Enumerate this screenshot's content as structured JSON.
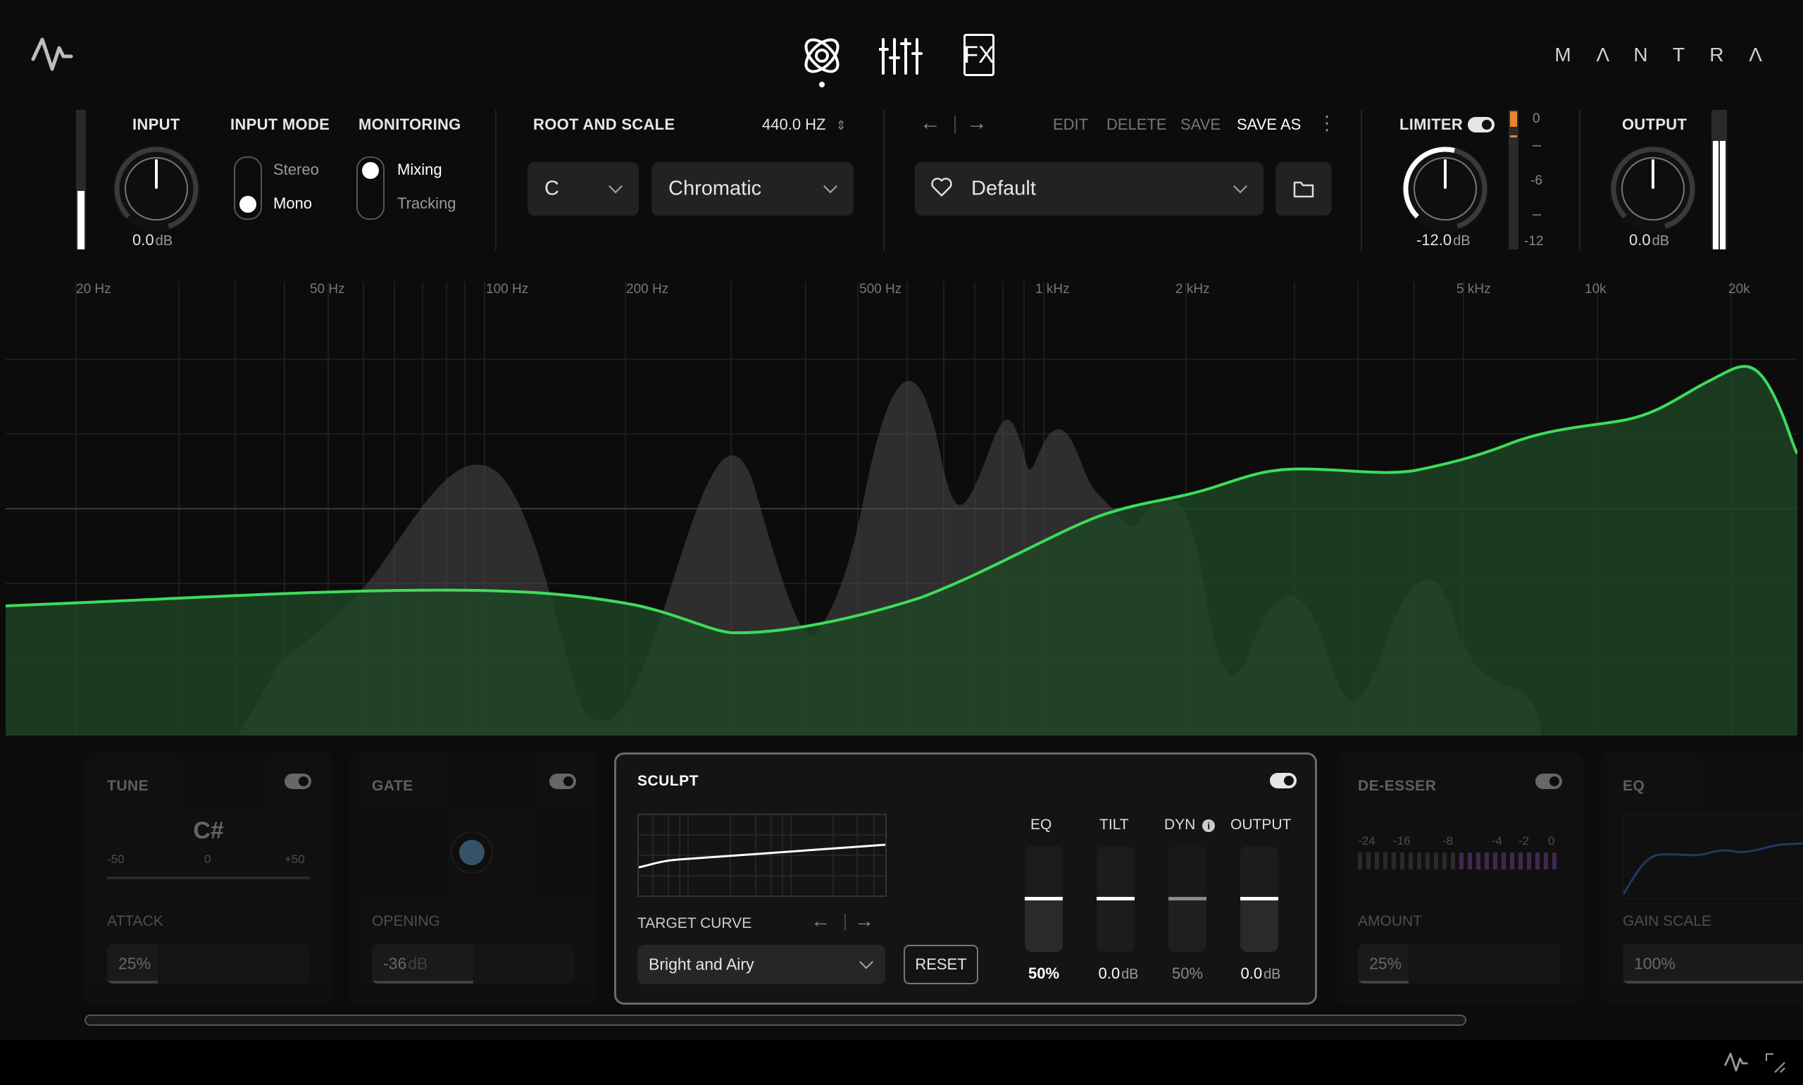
{
  "header": {
    "brand": "M Λ N T R Λ",
    "tabs": [
      "sculpt-tab",
      "mixer-tab",
      "fx-tab"
    ],
    "fx_label": "FX",
    "active_tab": 0
  },
  "input": {
    "label": "INPUT",
    "value": "0.0",
    "unit": "dB",
    "meter_level": 0.42
  },
  "input_mode": {
    "label": "INPUT MODE",
    "options": [
      "Stereo",
      "Mono"
    ],
    "selected": "Mono"
  },
  "monitoring": {
    "label": "MONITORING",
    "options": [
      "Mixing",
      "Tracking"
    ],
    "selected": "Mixing"
  },
  "root_scale": {
    "label": "ROOT AND SCALE",
    "tuning": "440.0 HZ",
    "root": "C",
    "scale": "Chromatic"
  },
  "preset": {
    "actions": [
      "EDIT",
      "DELETE",
      "SAVE",
      "SAVE AS"
    ],
    "name": "Default"
  },
  "limiter": {
    "label": "LIMITER",
    "value": "-12.0",
    "unit": "dB",
    "scale": [
      "0",
      "-6",
      "-12"
    ],
    "enabled": true
  },
  "output": {
    "label": "OUTPUT",
    "value": "0.0",
    "unit": "dB",
    "meter_level": 0.78
  },
  "analyzer": {
    "freq_labels": [
      "20 Hz",
      "50 Hz",
      "100 Hz",
      "200 Hz",
      "500 Hz",
      "1 kHz",
      "2 kHz",
      "5 kHz",
      "10k",
      "20k"
    ]
  },
  "modules": {
    "tune": {
      "title": "TUNE",
      "note": "C#",
      "scale": [
        "-50",
        "0",
        "+50"
      ],
      "param_label": "ATTACK",
      "param_value": "25%",
      "param_fraction": 0.25,
      "enabled": true
    },
    "gate": {
      "title": "GATE",
      "param_label": "OPENING",
      "param_value": "-36",
      "param_unit": "dB",
      "param_fraction": 0.5,
      "enabled": true
    },
    "sculpt": {
      "title": "SCULPT",
      "enabled": true,
      "target_curve_label": "TARGET CURVE",
      "target_curve": "Bright and Airy",
      "reset_label": "RESET",
      "faders": [
        {
          "label": "EQ",
          "value": "50%",
          "unit": ""
        },
        {
          "label": "TILT",
          "value": "0.0",
          "unit": "dB"
        },
        {
          "label": "DYN",
          "value": "50%",
          "unit": ""
        },
        {
          "label": "OUTPUT",
          "value": "0.0",
          "unit": "dB"
        }
      ]
    },
    "de_esser": {
      "title": "DE-ESSER",
      "scale": [
        "-24",
        "-16",
        "-8",
        "-4",
        "-2",
        "0"
      ],
      "param_label": "AMOUNT",
      "param_value": "25%",
      "param_fraction": 0.25,
      "enabled": true
    },
    "eq": {
      "title": "EQ",
      "param_label": "GAIN SCALE",
      "param_value": "100%",
      "param_fraction": 1.0
    }
  },
  "colors": {
    "accent_green": "#3ddc5a",
    "limiter_orange": "#e8852a",
    "deesser_purple": "#8a4fa0"
  }
}
